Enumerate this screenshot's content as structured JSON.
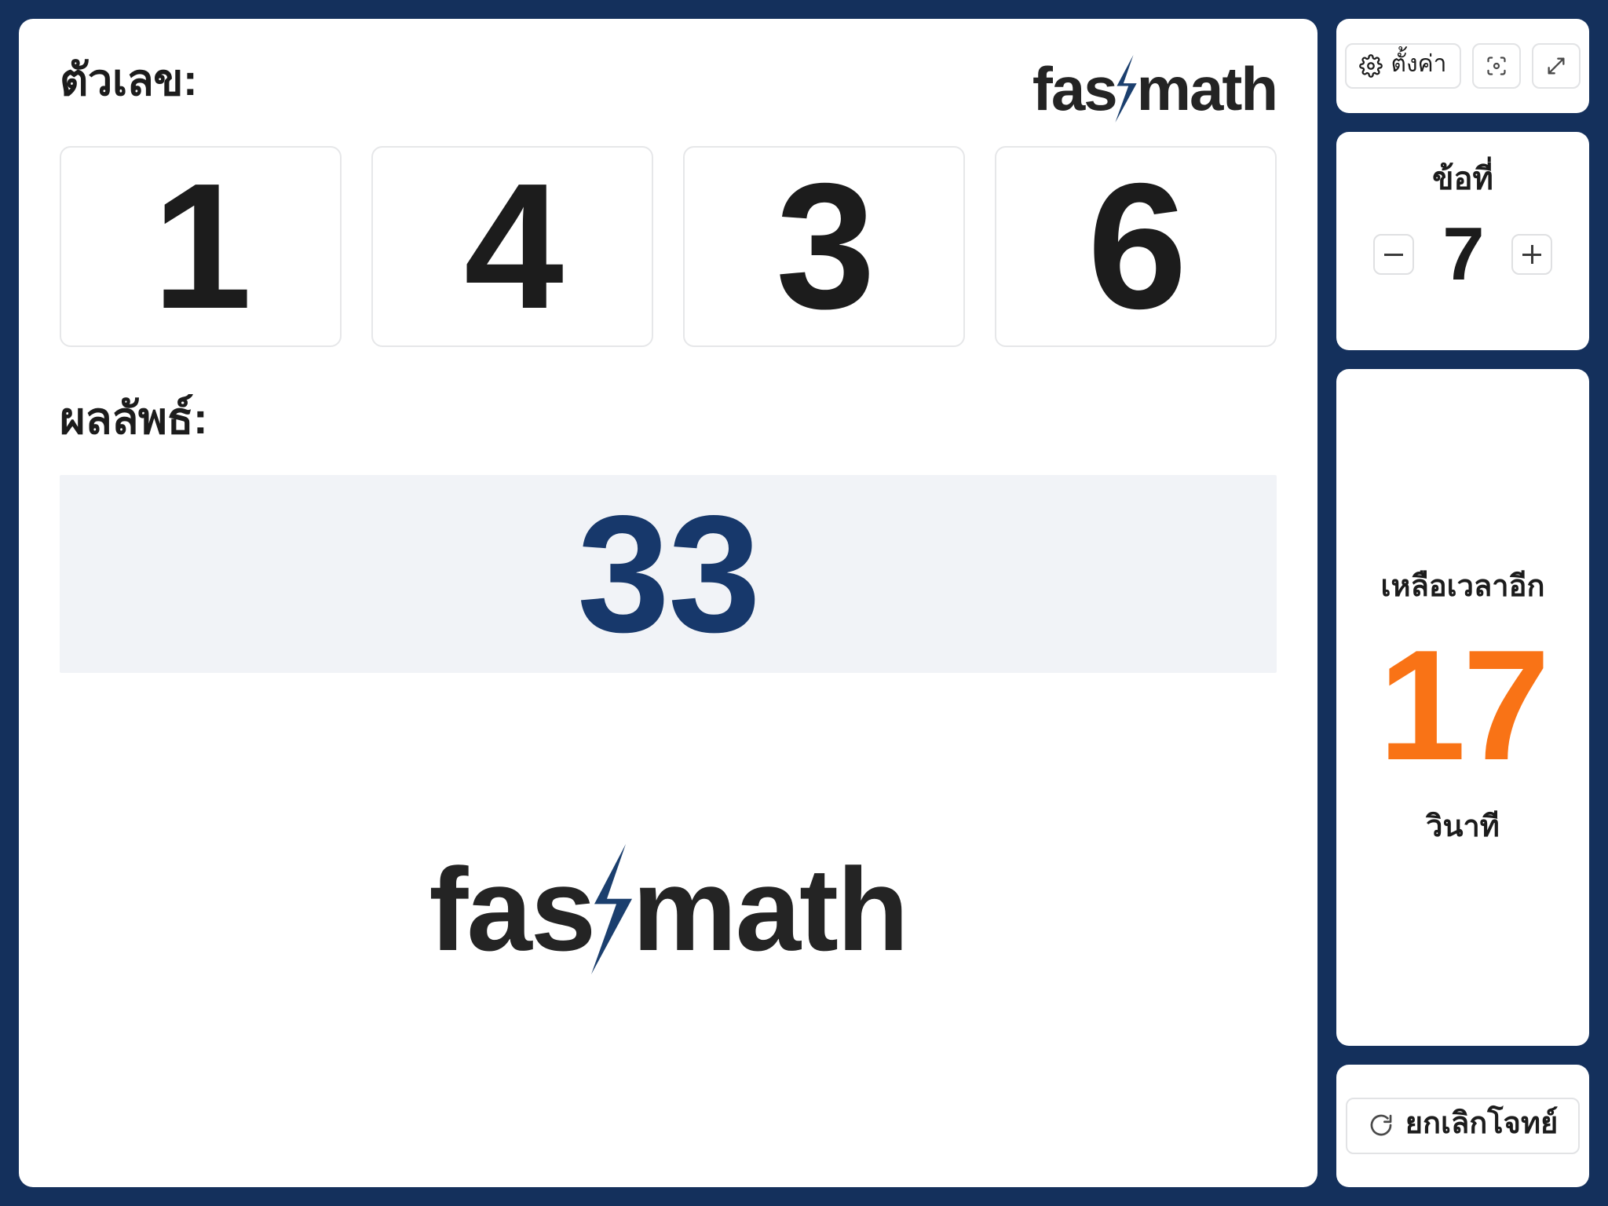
{
  "background_color": "#14305C",
  "main": {
    "numbers_label": "ตัวเลข:",
    "digits": [
      "1",
      "4",
      "3",
      "6"
    ],
    "result_label": "ผลลัพธ์:",
    "result_value": "33",
    "logo_word_left": "fas",
    "logo_word_right": "math",
    "logo_bolt_color": "#1B3F6E",
    "result_color": "#17386B"
  },
  "sidebar": {
    "tools": {
      "settings_label": "ตั้งค่า",
      "settings_icon": "gear-icon",
      "focus_icon": "scan-focus-icon",
      "expand_icon": "expand-arrows-icon"
    },
    "question": {
      "title": "ข้อที่",
      "value": "7",
      "decrement_label": "−",
      "increment_label": "+"
    },
    "timer": {
      "label": "เหลือเวลาอีก",
      "value": "17",
      "unit": "วินาที",
      "color": "#F97316"
    },
    "reset": {
      "label": "ยกเลิกโจทย์",
      "icon": "refresh-icon"
    }
  }
}
